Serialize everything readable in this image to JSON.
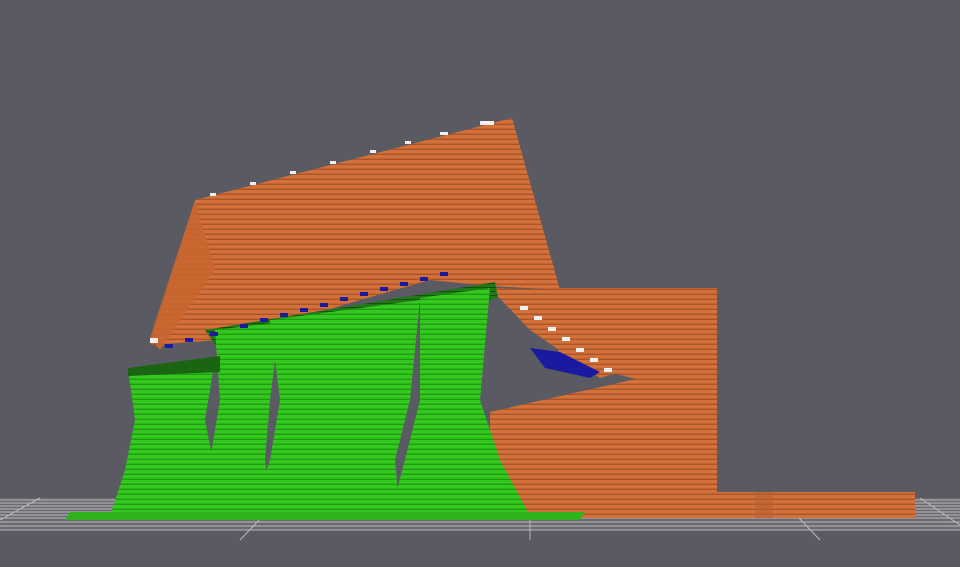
{
  "viewport": {
    "background_color": "#5a5a62",
    "bed_color": "#7a7a80",
    "bed_grid_color": "#c8c8cc",
    "shell_color": "#d4703a",
    "shell_line_color": "#b85e2e",
    "support_color": "#33c91f",
    "support_line_color": "#2aa818",
    "support_dark_color": "#1d6e14",
    "overhang_marker_color": "#1a1aa0",
    "bridge_marker_color": "#f0f0f0"
  }
}
